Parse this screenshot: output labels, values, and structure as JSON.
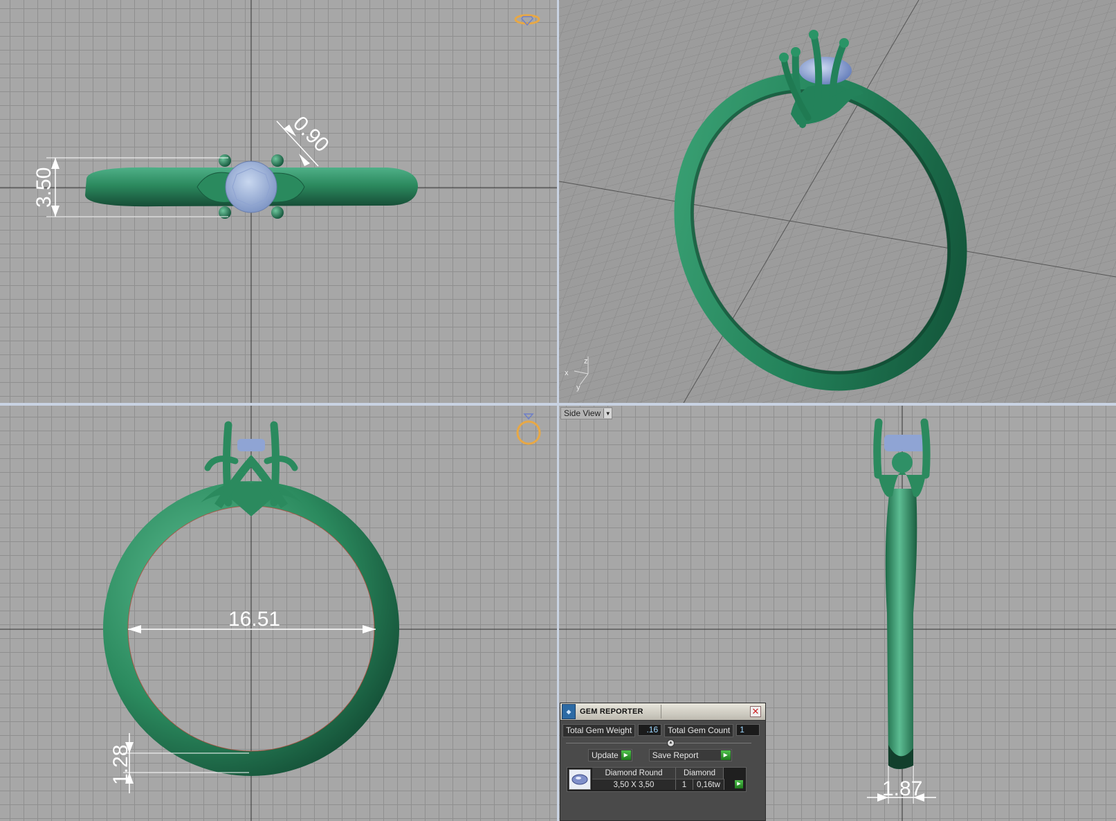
{
  "viewports": {
    "top": {
      "dimensions": {
        "height": "3.50",
        "prong": "0.90"
      }
    },
    "perspective": {
      "axes": {
        "x": "x",
        "y": "y",
        "z": "z"
      }
    },
    "front": {
      "dimensions": {
        "inner_diameter": "16.51",
        "band_thickness": "1.28"
      }
    },
    "side": {
      "menu_label": "Side View",
      "dimensions": {
        "band_width": "1.87"
      }
    }
  },
  "gem_reporter": {
    "title": "GEM REPORTER",
    "total_weight_label": "Total Gem Weight",
    "total_weight_value": ".16",
    "total_count_label": "Total Gem Count",
    "total_count_value": "1",
    "update_label": "Update",
    "save_report_label": "Save Report",
    "gem_list": {
      "headers": [
        "Diamond Round",
        "Diamond"
      ],
      "row": {
        "size": "3,50 X 3,50",
        "count": "1",
        "weight": "0,16tw"
      }
    }
  },
  "colors": {
    "metal": "#2e8a60",
    "gem": "#9eb4dc",
    "viewport_bg": "#a7a7a7",
    "grid_major": "#777777",
    "view_icon": "#e8a845"
  },
  "icons": {
    "close": "close-icon",
    "go": "play-arrow-icon",
    "view_cube_top": "diamond-ring-icon",
    "view_cube_front": "ring-icon"
  }
}
